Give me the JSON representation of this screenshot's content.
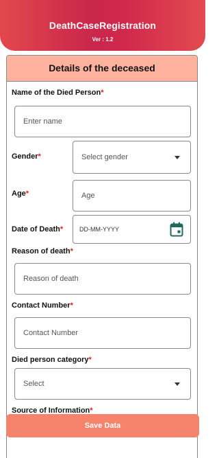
{
  "app": {
    "title": "DeathCaseRegistration",
    "version": "Ver : 1.2"
  },
  "card": {
    "title": "Details of the deceased"
  },
  "required_mark": "*",
  "fields": {
    "name": {
      "label": "Name of the Died Person",
      "placeholder": "Enter name"
    },
    "gender": {
      "label": "Gender",
      "placeholder": "Select gender"
    },
    "age": {
      "label": "Age",
      "placeholder": "Age"
    },
    "date_of_death": {
      "label": "Date of Death",
      "placeholder": "DD-MM-YYYY"
    },
    "reason": {
      "label": "Reason of death",
      "placeholder": "Reason of death"
    },
    "contact": {
      "label": "Contact Number",
      "placeholder": "Contact Number"
    },
    "category": {
      "label": "Died person category",
      "placeholder": "Select"
    },
    "source": {
      "label": "Source of Information"
    }
  },
  "actions": {
    "save_label": "Save Data"
  },
  "icons": {
    "date_picker": "calendar-icon",
    "dropdown": "chevron-down-icon"
  },
  "colors": {
    "header_gradient_start": "#e2474c",
    "header_gradient_mid": "#c9274c",
    "card_header_bg": "#ffb39e",
    "required": "#e0211f",
    "save_button": "#f6836b",
    "calendar_icon": "#1e6b5c"
  }
}
